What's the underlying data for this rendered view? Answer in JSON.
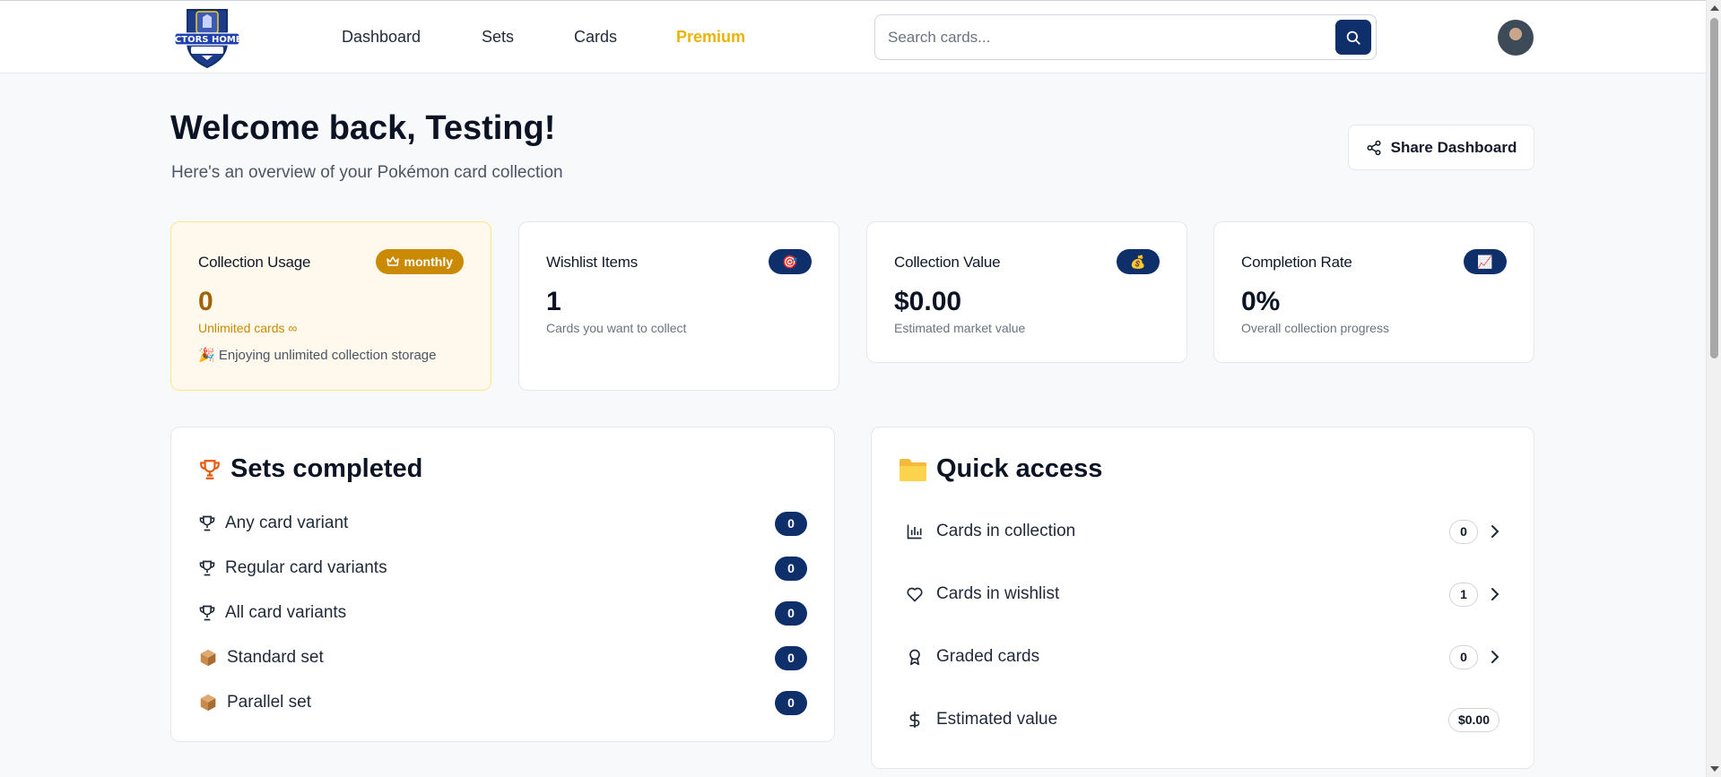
{
  "header": {
    "logo_text": "COLLECTORS HOME BASE",
    "nav": [
      {
        "label": "Dashboard"
      },
      {
        "label": "Sets"
      },
      {
        "label": "Cards"
      },
      {
        "label": "Premium"
      }
    ],
    "search": {
      "placeholder": "Search cards..."
    },
    "search_icon": "search-icon",
    "accent_color": "#0f2f6b",
    "premium_color": "#eab308"
  },
  "welcome": {
    "title": "Welcome back, Testing!",
    "subtitle": "Here's an overview of your Pokémon card collection",
    "share_label": "Share Dashboard"
  },
  "stats": {
    "usage": {
      "label": "Collection Usage",
      "badge": "monthly",
      "value": "0",
      "note": "Unlimited cards ∞",
      "extra": "🎉 Enjoying unlimited collection storage"
    },
    "wishlist": {
      "label": "Wishlist Items",
      "badge": "🎯",
      "value": "1",
      "note": "Cards you want to collect"
    },
    "value": {
      "label": "Collection Value",
      "badge": "💰",
      "value": "$0.00",
      "note": "Estimated market value"
    },
    "completion": {
      "label": "Completion Rate",
      "badge": "📈",
      "value": "0%",
      "note": "Overall collection progress"
    }
  },
  "sets_completed": {
    "title": "Sets completed",
    "rows": [
      {
        "label": "Any card variant",
        "count": "0",
        "icon": "trophy-icon"
      },
      {
        "label": "Regular card variants",
        "count": "0",
        "icon": "trophy-icon"
      },
      {
        "label": "All card variants",
        "count": "0",
        "icon": "trophy-icon"
      },
      {
        "label": "Standard set",
        "count": "0",
        "icon": "package-icon"
      },
      {
        "label": "Parallel set",
        "count": "0",
        "icon": "package-icon"
      }
    ]
  },
  "quick_access": {
    "title": "Quick access",
    "rows": [
      {
        "label": "Cards in collection",
        "count": "0",
        "icon": "bar-chart-icon"
      },
      {
        "label": "Cards in wishlist",
        "count": "1",
        "icon": "heart-icon"
      },
      {
        "label": "Graded cards",
        "count": "0",
        "icon": "award-icon"
      },
      {
        "label": "Estimated value",
        "count": "$0.00",
        "icon": "dollar-icon"
      }
    ]
  }
}
